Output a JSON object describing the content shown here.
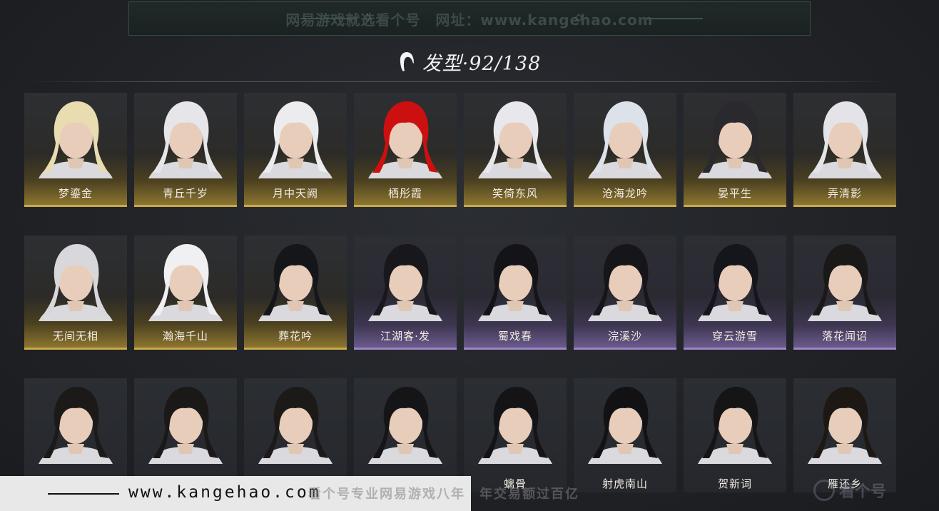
{
  "watermark_top": "网易游戏就选看个号　网址：www.kangehao.com",
  "header": {
    "title": "发型·92/138"
  },
  "cards": [
    {
      "label": "梦鎏金",
      "rarity": "gold",
      "hair": "#e8dcb0"
    },
    {
      "label": "青丘千岁",
      "rarity": "gold",
      "hair": "#e6e6ea"
    },
    {
      "label": "月中天阙",
      "rarity": "gold",
      "hair": "#ececef"
    },
    {
      "label": "栖彤霞",
      "rarity": "gold",
      "hair": "#cc1010"
    },
    {
      "label": "笑倚东风",
      "rarity": "gold",
      "hair": "#e8e8ec"
    },
    {
      "label": "沧海龙吟",
      "rarity": "gold",
      "hair": "#dde2ea"
    },
    {
      "label": "晏平生",
      "rarity": "gold",
      "hair": "#2a2a2e"
    },
    {
      "label": "弄清影",
      "rarity": "gold",
      "hair": "#e4e4e8"
    },
    {
      "label": "无间无相",
      "rarity": "gold",
      "hair": "#d8d8dc"
    },
    {
      "label": "瀚海千山",
      "rarity": "gold",
      "hair": "#f0f0f2"
    },
    {
      "label": "葬花吟",
      "rarity": "gold",
      "hair": "#15161a"
    },
    {
      "label": "江湖客·发",
      "rarity": "purple",
      "hair": "#18181c"
    },
    {
      "label": "蜀戏春",
      "rarity": "purple",
      "hair": "#141418"
    },
    {
      "label": "浣溪沙",
      "rarity": "purple",
      "hair": "#16161a"
    },
    {
      "label": "穿云游雪",
      "rarity": "purple",
      "hair": "#15161c"
    },
    {
      "label": "落花闻诏",
      "rarity": "purple",
      "hair": "#1a1918"
    },
    {
      "label": "",
      "rarity": "plain",
      "hair": "#1c1a18"
    },
    {
      "label": "",
      "rarity": "plain",
      "hair": "#1a1918"
    },
    {
      "label": "",
      "rarity": "plain",
      "hair": "#1c1a18"
    },
    {
      "label": "",
      "rarity": "plain",
      "hair": "#151518"
    },
    {
      "label": "螭骨",
      "rarity": "plain",
      "hair": "#141416"
    },
    {
      "label": "射虎南山",
      "rarity": "plain",
      "hair": "#121214"
    },
    {
      "label": "贺新词",
      "rarity": "plain",
      "hair": "#151516"
    },
    {
      "label": "雁还乡",
      "rarity": "plain",
      "hair": "#1e1814"
    }
  ],
  "footer": {
    "url": "www.kangehao.com",
    "slogan": "看个号专业网易游戏八年　年交易额过百亿",
    "logo": "看个号"
  }
}
